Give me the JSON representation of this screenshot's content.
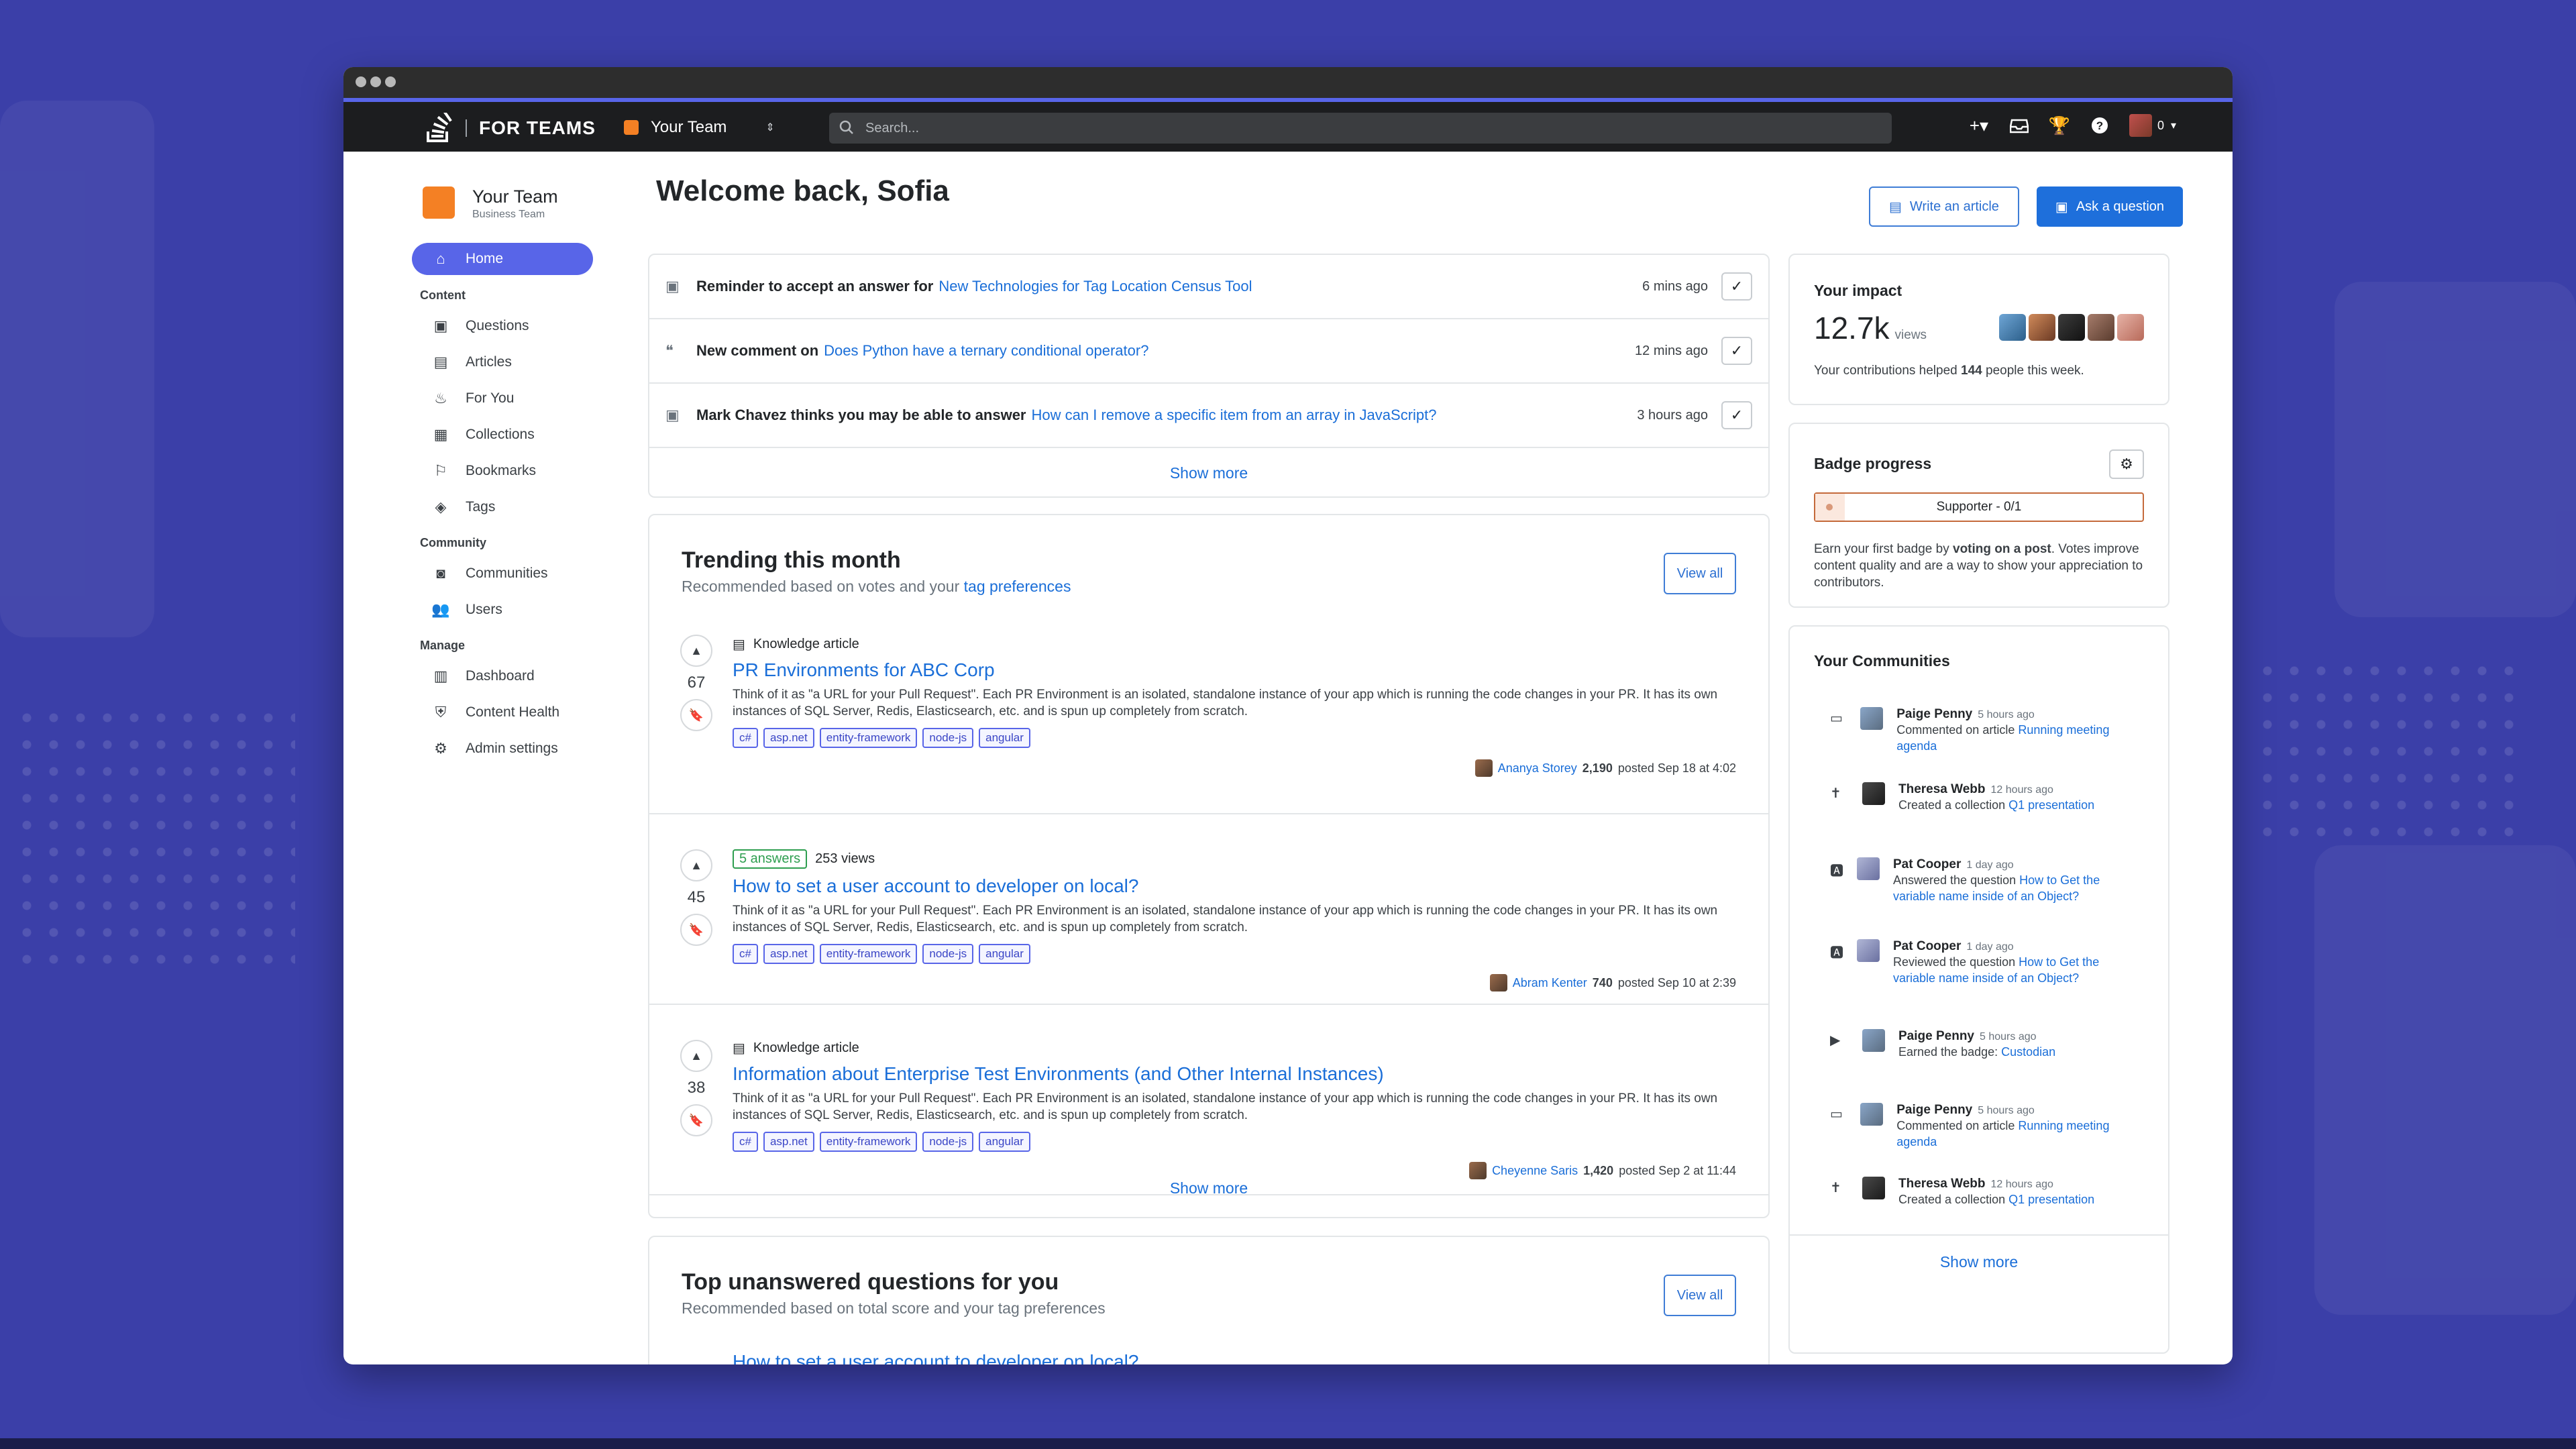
{
  "app": {
    "brand": "FOR TEAMS",
    "team": "Your Team"
  },
  "search": {
    "placeholder": "Search..."
  },
  "topbar": {
    "user_count": "0"
  },
  "sidebar": {
    "team_name": "Your Team",
    "team_plan": "Business Team",
    "home": "Home",
    "sections": [
      {
        "title": "Content",
        "items": [
          "Questions",
          "Articles",
          "For You",
          "Collections",
          "Bookmarks",
          "Tags"
        ]
      },
      {
        "title": "Community",
        "items": [
          "Communities",
          "Users"
        ]
      },
      {
        "title": "Manage",
        "items": [
          "Dashboard",
          "Content Health",
          "Admin settings"
        ]
      }
    ]
  },
  "header": {
    "welcome": "Welcome back, Sofia",
    "write_article": "Write an article",
    "ask_question": "Ask a question"
  },
  "notifications": [
    {
      "prefix": "Reminder to accept an answer for",
      "link": "New Technologies for Tag Location Census Tool",
      "time": "6 mins ago"
    },
    {
      "prefix": "New comment on",
      "link": "Does Python have a ternary conditional operator?",
      "time": "12 mins ago"
    },
    {
      "prefix": "Mark Chavez thinks you may be able to answer",
      "link": "How can I remove a specific item from an array in JavaScript?",
      "time": "3 hours ago"
    }
  ],
  "notifications_show_more": "Show more",
  "trending": {
    "title": "Trending this month",
    "subtitle": "Recommended based on votes and your",
    "subtitle_link": "tag preferences",
    "view_all": "View all",
    "show_more": "Show more",
    "posts": [
      {
        "votes": "67",
        "meta": "Knowledge article",
        "title": "PR Environments for ABC Corp",
        "excerpt": "Think of it as \"a URL for your Pull Request\". Each PR Environment is an isolated, standalone instance of your app which is running the code changes in your PR. It has its own instances of SQL Server, Redis, Elasticsearch, etc. and is spun up completely from scratch.",
        "tags": [
          "c#",
          "asp.net",
          "entity-framework",
          "node-js",
          "angular"
        ],
        "author": "Ananya Storey",
        "rep": "2,190",
        "posted": "posted Sep 18 at 4:02"
      },
      {
        "votes": "45",
        "answers": "5 answers",
        "views": "253 views",
        "title": "How to set a user account to developer on local?",
        "excerpt": "Think of it as \"a URL for your Pull Request\". Each PR Environment is an isolated, standalone instance of your app which is running the code changes in your PR. It has its own instances of SQL Server, Redis, Elasticsearch, etc. and is spun up completely from scratch.",
        "tags": [
          "c#",
          "asp.net",
          "entity-framework",
          "node-js",
          "angular"
        ],
        "author": "Abram Kenter",
        "rep": "740",
        "posted": "posted Sep 10 at 2:39"
      },
      {
        "votes": "38",
        "meta": "Knowledge article",
        "title": "Information about Enterprise Test Environments (and Other Internal Instances)",
        "excerpt": "Think of it as \"a URL for your Pull Request\". Each PR Environment is an isolated, standalone instance of your app which is running the code changes in your PR. It has its own instances of SQL Server, Redis, Elasticsearch, etc. and is spun up completely from scratch.",
        "tags": [
          "c#",
          "asp.net",
          "entity-framework",
          "node-js",
          "angular"
        ],
        "author": "Cheyenne Saris",
        "rep": "1,420",
        "posted": "posted Sep 2 at 11:44"
      }
    ]
  },
  "unanswered": {
    "title": "Top unanswered questions for you",
    "subtitle": "Recommended based on total score and your tag preferences",
    "view_all": "View all",
    "first_title": "How to set a user account to developer on local?"
  },
  "impact": {
    "title": "Your impact",
    "views": "12.7k",
    "views_unit": "views",
    "text_before": "Your contributions helped",
    "count": "144",
    "text_after": "people this week."
  },
  "badge": {
    "title": "Badge progress",
    "progress_label": "Supporter - 0/1",
    "progress_value": 0,
    "text_before": "Earn your first badge by",
    "text_bold": "voting on a post",
    "text_after": ". Votes improve content quality and are a way to show your appreciation to contributors."
  },
  "communities": {
    "title": "Your Communities",
    "show_more": "Show more",
    "activity": [
      {
        "icon": "comment-icon",
        "name": "Paige Penny",
        "time": "5 hours ago",
        "action": "Commented on article",
        "link": "Running meeting agenda"
      },
      {
        "icon": "collection-icon",
        "name": "Theresa Webb",
        "time": "12 hours ago",
        "action": "Created a collection",
        "link": "Q1 presentation"
      },
      {
        "icon": "answer-icon",
        "name": "Pat Cooper",
        "time": "1 day ago",
        "action": "Answered the question",
        "link": "How to Get the variable name inside of an Object?"
      },
      {
        "icon": "answer-icon",
        "name": "Pat Cooper",
        "time": "1 day ago",
        "action": "Reviewed the question",
        "link": "How to Get the variable name inside of an Object?"
      },
      {
        "icon": "badge-icon",
        "name": "Paige Penny",
        "time": "5 hours ago",
        "action": "Earned the badge:",
        "link": "Custodian"
      },
      {
        "icon": "comment-icon",
        "name": "Paige Penny",
        "time": "5 hours ago",
        "action": "Commented on article",
        "link": "Running meeting agenda"
      },
      {
        "icon": "collection-icon",
        "name": "Theresa Webb",
        "time": "12 hours ago",
        "action": "Created a collection",
        "link": "Q1 presentation"
      }
    ]
  },
  "colors": {
    "accent": "#5865e8",
    "link": "#1a6ed8",
    "brand_orange": "#f48024",
    "background": "#3b3fa8"
  }
}
